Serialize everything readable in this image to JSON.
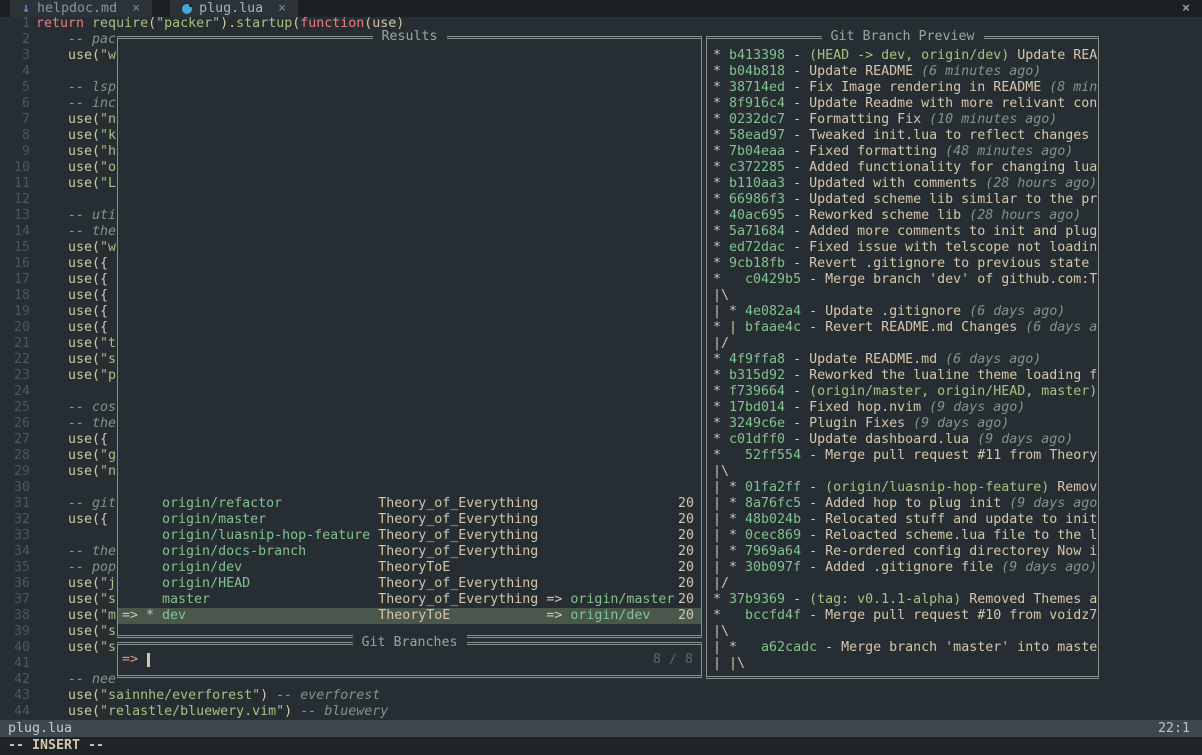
{
  "tabbar": {
    "tabs": [
      {
        "label": "helpdoc.md",
        "icon": "markdown-icon",
        "icon_glyph": "↓",
        "close": "×"
      },
      {
        "label": "plug.lua",
        "icon": "lua-icon",
        "icon_glyph": "",
        "close": "×"
      }
    ],
    "window_close": "×"
  },
  "editor": {
    "lines": [
      {
        "n": "1",
        "segs": [
          [
            "return ",
            "kw"
          ],
          [
            "require",
            "fn"
          ],
          [
            "(",
            "fg"
          ],
          [
            "\"packer\"",
            "str"
          ],
          [
            ").",
            "fg"
          ],
          [
            "startup",
            "fn"
          ],
          [
            "(",
            "fg"
          ],
          [
            "function",
            "kw"
          ],
          [
            "(use)",
            "fg"
          ]
        ]
      },
      {
        "n": "2",
        "segs": [
          [
            "    -- pac",
            "cm"
          ]
        ]
      },
      {
        "n": "3",
        "segs": [
          [
            "    use(",
            "fg"
          ],
          [
            "\"w",
            "str"
          ]
        ]
      },
      {
        "n": "4",
        "segs": []
      },
      {
        "n": "5",
        "segs": [
          [
            "    -- lsp",
            "cm"
          ]
        ]
      },
      {
        "n": "6",
        "segs": [
          [
            "    -- inc",
            "cm"
          ]
        ]
      },
      {
        "n": "7",
        "segs": [
          [
            "    use(",
            "fg"
          ],
          [
            "\"n",
            "str"
          ]
        ]
      },
      {
        "n": "8",
        "segs": [
          [
            "    use(",
            "fg"
          ],
          [
            "\"k",
            "str"
          ]
        ]
      },
      {
        "n": "9",
        "segs": [
          [
            "    use(",
            "fg"
          ],
          [
            "\"h",
            "str"
          ]
        ]
      },
      {
        "n": "10",
        "segs": [
          [
            "    use(",
            "fg"
          ],
          [
            "\"o",
            "str"
          ]
        ]
      },
      {
        "n": "11",
        "segs": [
          [
            "    use(",
            "fg"
          ],
          [
            "\"L",
            "str"
          ]
        ]
      },
      {
        "n": "12",
        "segs": []
      },
      {
        "n": "13",
        "segs": [
          [
            "    -- uti",
            "cm"
          ]
        ]
      },
      {
        "n": "14",
        "segs": [
          [
            "    -- the",
            "cm"
          ]
        ]
      },
      {
        "n": "15",
        "segs": [
          [
            "    use(",
            "fg"
          ],
          [
            "\"w",
            "str"
          ]
        ]
      },
      {
        "n": "16",
        "segs": [
          [
            "    use({",
            "fg"
          ]
        ]
      },
      {
        "n": "17",
        "segs": [
          [
            "    use({",
            "fg"
          ]
        ]
      },
      {
        "n": "18",
        "segs": [
          [
            "    use({",
            "fg"
          ]
        ]
      },
      {
        "n": "19",
        "segs": [
          [
            "    use({",
            "fg"
          ]
        ]
      },
      {
        "n": "20",
        "segs": [
          [
            "    use({",
            "fg"
          ]
        ]
      },
      {
        "n": "21",
        "segs": [
          [
            "    use(",
            "fg"
          ],
          [
            "\"t",
            "str"
          ]
        ]
      },
      {
        "n": "22",
        "segs": [
          [
            "    use(",
            "fg"
          ],
          [
            "\"s",
            "str"
          ]
        ]
      },
      {
        "n": "23",
        "segs": [
          [
            "    use(",
            "fg"
          ],
          [
            "\"p",
            "str"
          ]
        ]
      },
      {
        "n": "24",
        "segs": []
      },
      {
        "n": "25",
        "segs": [
          [
            "    -- cos",
            "cm"
          ]
        ]
      },
      {
        "n": "26",
        "segs": [
          [
            "    -- the",
            "cm"
          ]
        ]
      },
      {
        "n": "27",
        "segs": [
          [
            "    use({",
            "fg"
          ]
        ]
      },
      {
        "n": "28",
        "segs": [
          [
            "    use(",
            "fg"
          ],
          [
            "\"g",
            "str"
          ]
        ]
      },
      {
        "n": "29",
        "segs": [
          [
            "    use(",
            "fg"
          ],
          [
            "\"n",
            "str"
          ]
        ]
      },
      {
        "n": "30",
        "segs": []
      },
      {
        "n": "31",
        "segs": [
          [
            "    -- git",
            "cm"
          ]
        ]
      },
      {
        "n": "32",
        "segs": [
          [
            "    use({",
            "fg"
          ]
        ]
      },
      {
        "n": "33",
        "segs": []
      },
      {
        "n": "34",
        "segs": [
          [
            "    -- the",
            "cm"
          ]
        ]
      },
      {
        "n": "35",
        "segs": [
          [
            "    -- pop",
            "cm"
          ]
        ]
      },
      {
        "n": "36",
        "segs": [
          [
            "    use(",
            "fg"
          ],
          [
            "\"j",
            "str"
          ]
        ]
      },
      {
        "n": "37",
        "segs": [
          [
            "    use(",
            "fg"
          ],
          [
            "\"s",
            "str"
          ]
        ]
      },
      {
        "n": "38",
        "segs": [
          [
            "    use(",
            "fg"
          ],
          [
            "\"m",
            "str"
          ]
        ]
      },
      {
        "n": "39",
        "segs": [
          [
            "    use(",
            "fg"
          ],
          [
            "\"s",
            "str"
          ]
        ]
      },
      {
        "n": "40",
        "segs": [
          [
            "    use(",
            "fg"
          ],
          [
            "\"s",
            "str"
          ]
        ]
      },
      {
        "n": "41",
        "segs": []
      },
      {
        "n": "42",
        "segs": [
          [
            "    -- nee",
            "cm"
          ]
        ]
      },
      {
        "n": "43",
        "segs": [
          [
            "    use(",
            "fg"
          ],
          [
            "\"sainnhe/everforest\"",
            "str"
          ],
          [
            ") ",
            "fg"
          ],
          [
            "-- everforest",
            "cm"
          ]
        ]
      },
      {
        "n": "44",
        "segs": [
          [
            "    use(",
            "fg"
          ],
          [
            "\"relastle/bluewery.vim\"",
            "str"
          ],
          [
            ") ",
            "fg"
          ],
          [
            "-- bluewery",
            "cm"
          ]
        ]
      }
    ]
  },
  "results_window": {
    "title": "Results",
    "items": [
      {
        "prefix": "     ",
        "branch": "origin/refactor",
        "repo": "Theory_of_Everything",
        "upstream": "",
        "date": "20",
        "selected": false
      },
      {
        "prefix": "     ",
        "branch": "origin/master",
        "repo": "Theory_of_Everything",
        "upstream": "",
        "date": "20",
        "selected": false
      },
      {
        "prefix": "     ",
        "branch": "origin/luasnip-hop-feature",
        "repo": "Theory_of_Everything",
        "upstream": "",
        "date": "20",
        "selected": false
      },
      {
        "prefix": "     ",
        "branch": "origin/docs-branch",
        "repo": "Theory_of_Everything",
        "upstream": "",
        "date": "20",
        "selected": false
      },
      {
        "prefix": "     ",
        "branch": "origin/dev",
        "repo": "TheoryToE",
        "upstream": "",
        "date": "20",
        "selected": false
      },
      {
        "prefix": "     ",
        "branch": "origin/HEAD",
        "repo": "Theory_of_Everything",
        "upstream": "",
        "date": "20",
        "selected": false
      },
      {
        "prefix": "     ",
        "branch": "master",
        "repo": "Theory_of_Everything",
        "upstream": "origin/master",
        "date": "20",
        "selected": false
      },
      {
        "prefix": "=> * ",
        "branch": "dev",
        "repo": "TheoryToE",
        "upstream": "origin/dev",
        "date": "20",
        "selected": true
      }
    ]
  },
  "prompt_window": {
    "title": "Git Branches",
    "prompt": "=>",
    "counter": "8 / 8"
  },
  "preview_window": {
    "title": "Git Branch Preview",
    "lines": [
      [
        [
          "* ",
          "fg"
        ],
        [
          "b413398",
          "hash"
        ],
        [
          " - ",
          "fg"
        ],
        [
          "(HEAD -> dev, origin/dev)",
          "dec"
        ],
        [
          " Update REA",
          "fg"
        ]
      ],
      [
        [
          "* ",
          "fg"
        ],
        [
          "b04b818",
          "hash"
        ],
        [
          " - Update README ",
          "fg"
        ],
        [
          "(6 minutes ago)",
          "time"
        ]
      ],
      [
        [
          "* ",
          "fg"
        ],
        [
          "38714ed",
          "hash"
        ],
        [
          " - Fix Image rendering in README ",
          "fg"
        ],
        [
          "(8 min",
          "time"
        ]
      ],
      [
        [
          "* ",
          "fg"
        ],
        [
          "8f916c4",
          "hash"
        ],
        [
          " - Update Readme with more relivant con",
          "fg"
        ]
      ],
      [
        [
          "* ",
          "fg"
        ],
        [
          "0232dc7",
          "hash"
        ],
        [
          " - Formatting Fix ",
          "fg"
        ],
        [
          "(10 minutes ago)",
          "time"
        ]
      ],
      [
        [
          "* ",
          "fg"
        ],
        [
          "58ead97",
          "hash"
        ],
        [
          " - Tweaked init.lua to reflect changes",
          "fg"
        ]
      ],
      [
        [
          "* ",
          "fg"
        ],
        [
          "7b04eaa",
          "hash"
        ],
        [
          " - Fixed formatting ",
          "fg"
        ],
        [
          "(48 minutes ago)",
          "time"
        ]
      ],
      [
        [
          "* ",
          "fg"
        ],
        [
          "c372285",
          "hash"
        ],
        [
          " - Added functionality for changing lua",
          "fg"
        ]
      ],
      [
        [
          "* ",
          "fg"
        ],
        [
          "b110aa3",
          "hash"
        ],
        [
          " - Updated with comments ",
          "fg"
        ],
        [
          "(28 hours ago)",
          "time"
        ]
      ],
      [
        [
          "* ",
          "fg"
        ],
        [
          "66986f3",
          "hash"
        ],
        [
          " - Updated scheme lib similar to the pr",
          "fg"
        ]
      ],
      [
        [
          "* ",
          "fg"
        ],
        [
          "40ac695",
          "hash"
        ],
        [
          " - Reworked scheme lib ",
          "fg"
        ],
        [
          "(28 hours ago)",
          "time"
        ]
      ],
      [
        [
          "* ",
          "fg"
        ],
        [
          "5a71684",
          "hash"
        ],
        [
          " - Added more comments to init and plug",
          "fg"
        ]
      ],
      [
        [
          "* ",
          "fg"
        ],
        [
          "ed72dac",
          "hash"
        ],
        [
          " - Fixed issue with telscope not loadin",
          "fg"
        ]
      ],
      [
        [
          "* ",
          "fg"
        ],
        [
          "9cb18fb",
          "hash"
        ],
        [
          " - Revert .gitignore to previous state",
          "fg"
        ]
      ],
      [
        [
          "*   ",
          "fg"
        ],
        [
          "c0429b5",
          "hash"
        ],
        [
          " - Merge branch 'dev' of github.com:T",
          "fg"
        ]
      ],
      [
        [
          "|\\",
          "fg"
        ]
      ],
      [
        [
          "| * ",
          "fg"
        ],
        [
          "4e082a4",
          "hash"
        ],
        [
          " - Update .gitignore ",
          "fg"
        ],
        [
          "(6 days ago)",
          "time"
        ]
      ],
      [
        [
          "* | ",
          "fg"
        ],
        [
          "bfaae4c",
          "hash"
        ],
        [
          " - Revert README.md Changes ",
          "fg"
        ],
        [
          "(6 days a",
          "time"
        ]
      ],
      [
        [
          "|/",
          "fg"
        ]
      ],
      [
        [
          "* ",
          "fg"
        ],
        [
          "4f9ffa8",
          "hash"
        ],
        [
          " - Update README.md ",
          "fg"
        ],
        [
          "(6 days ago)",
          "time"
        ]
      ],
      [
        [
          "* ",
          "fg"
        ],
        [
          "b315d92",
          "hash"
        ],
        [
          " - Reworked the lualine theme loading f",
          "fg"
        ]
      ],
      [
        [
          "* ",
          "fg"
        ],
        [
          "f739664",
          "hash"
        ],
        [
          " - ",
          "fg"
        ],
        [
          "(origin/master, origin/HEAD, master)",
          "dec"
        ]
      ],
      [
        [
          "* ",
          "fg"
        ],
        [
          "17bd014",
          "hash"
        ],
        [
          " - Fixed hop.nvim ",
          "fg"
        ],
        [
          "(9 days ago)",
          "time"
        ]
      ],
      [
        [
          "* ",
          "fg"
        ],
        [
          "3249c6e",
          "hash"
        ],
        [
          " - Plugin Fixes ",
          "fg"
        ],
        [
          "(9 days ago)",
          "time"
        ]
      ],
      [
        [
          "* ",
          "fg"
        ],
        [
          "c01dff0",
          "hash"
        ],
        [
          " - Update dashboard.lua ",
          "fg"
        ],
        [
          "(9 days ago)",
          "time"
        ]
      ],
      [
        [
          "*   ",
          "fg"
        ],
        [
          "52ff554",
          "hash"
        ],
        [
          " - Merge pull request #11 from Theory",
          "fg"
        ]
      ],
      [
        [
          "|\\",
          "fg"
        ]
      ],
      [
        [
          "| * ",
          "fg"
        ],
        [
          "01fa2ff",
          "hash"
        ],
        [
          " - ",
          "fg"
        ],
        [
          "(origin/luasnip-hop-feature)",
          "dec"
        ],
        [
          " Remov",
          "fg"
        ]
      ],
      [
        [
          "| * ",
          "fg"
        ],
        [
          "8a76fc5",
          "hash"
        ],
        [
          " - Added hop to plug init ",
          "fg"
        ],
        [
          "(9 days ago",
          "time"
        ]
      ],
      [
        [
          "| * ",
          "fg"
        ],
        [
          "48b024b",
          "hash"
        ],
        [
          " - Relocated stuff and update to init",
          "fg"
        ]
      ],
      [
        [
          "| * ",
          "fg"
        ],
        [
          "0cec869",
          "hash"
        ],
        [
          " - Reloacted scheme.lua file to the l",
          "fg"
        ]
      ],
      [
        [
          "| * ",
          "fg"
        ],
        [
          "7969a64",
          "hash"
        ],
        [
          " - Re-ordered config directorey Now i",
          "fg"
        ]
      ],
      [
        [
          "| * ",
          "fg"
        ],
        [
          "30b097f",
          "hash"
        ],
        [
          " - Added .gitignore file ",
          "fg"
        ],
        [
          "(9 days ago)",
          "time"
        ]
      ],
      [
        [
          "|/",
          "fg"
        ]
      ],
      [
        [
          "* ",
          "fg"
        ],
        [
          "37b9369",
          "hash"
        ],
        [
          " - ",
          "fg"
        ],
        [
          "(tag: v0.1.1-alpha)",
          "dec"
        ],
        [
          " Removed Themes a",
          "fg"
        ]
      ],
      [
        [
          "*   ",
          "fg"
        ],
        [
          "bccfd4f",
          "hash"
        ],
        [
          " - Merge pull request #10 from voidz7",
          "fg"
        ]
      ],
      [
        [
          "|\\",
          "fg"
        ]
      ],
      [
        [
          "| *   ",
          "fg"
        ],
        [
          "a62cadc",
          "hash"
        ],
        [
          " - Merge branch 'master' into maste",
          "fg"
        ]
      ],
      [
        [
          "| |\\",
          "fg"
        ]
      ]
    ]
  },
  "statusline": {
    "left": "plug.lua",
    "right": "22:1"
  },
  "cmdline": {
    "mode": "-- INSERT --"
  },
  "colors": {
    "bg": "#272e33",
    "fg": "#d3c6aa",
    "comment": "#859289",
    "red": "#e67e80",
    "green": "#a7c080",
    "aqua": "#83c092",
    "orange": "#e69875",
    "border": "#87928f",
    "selection_bg": "#4a574d",
    "statusline_bg": "#3d484d",
    "tabbar_bg": "#1b2024",
    "lua_icon_blue": "#4aa5d8",
    "md_icon_blue": "#5f93ce"
  }
}
